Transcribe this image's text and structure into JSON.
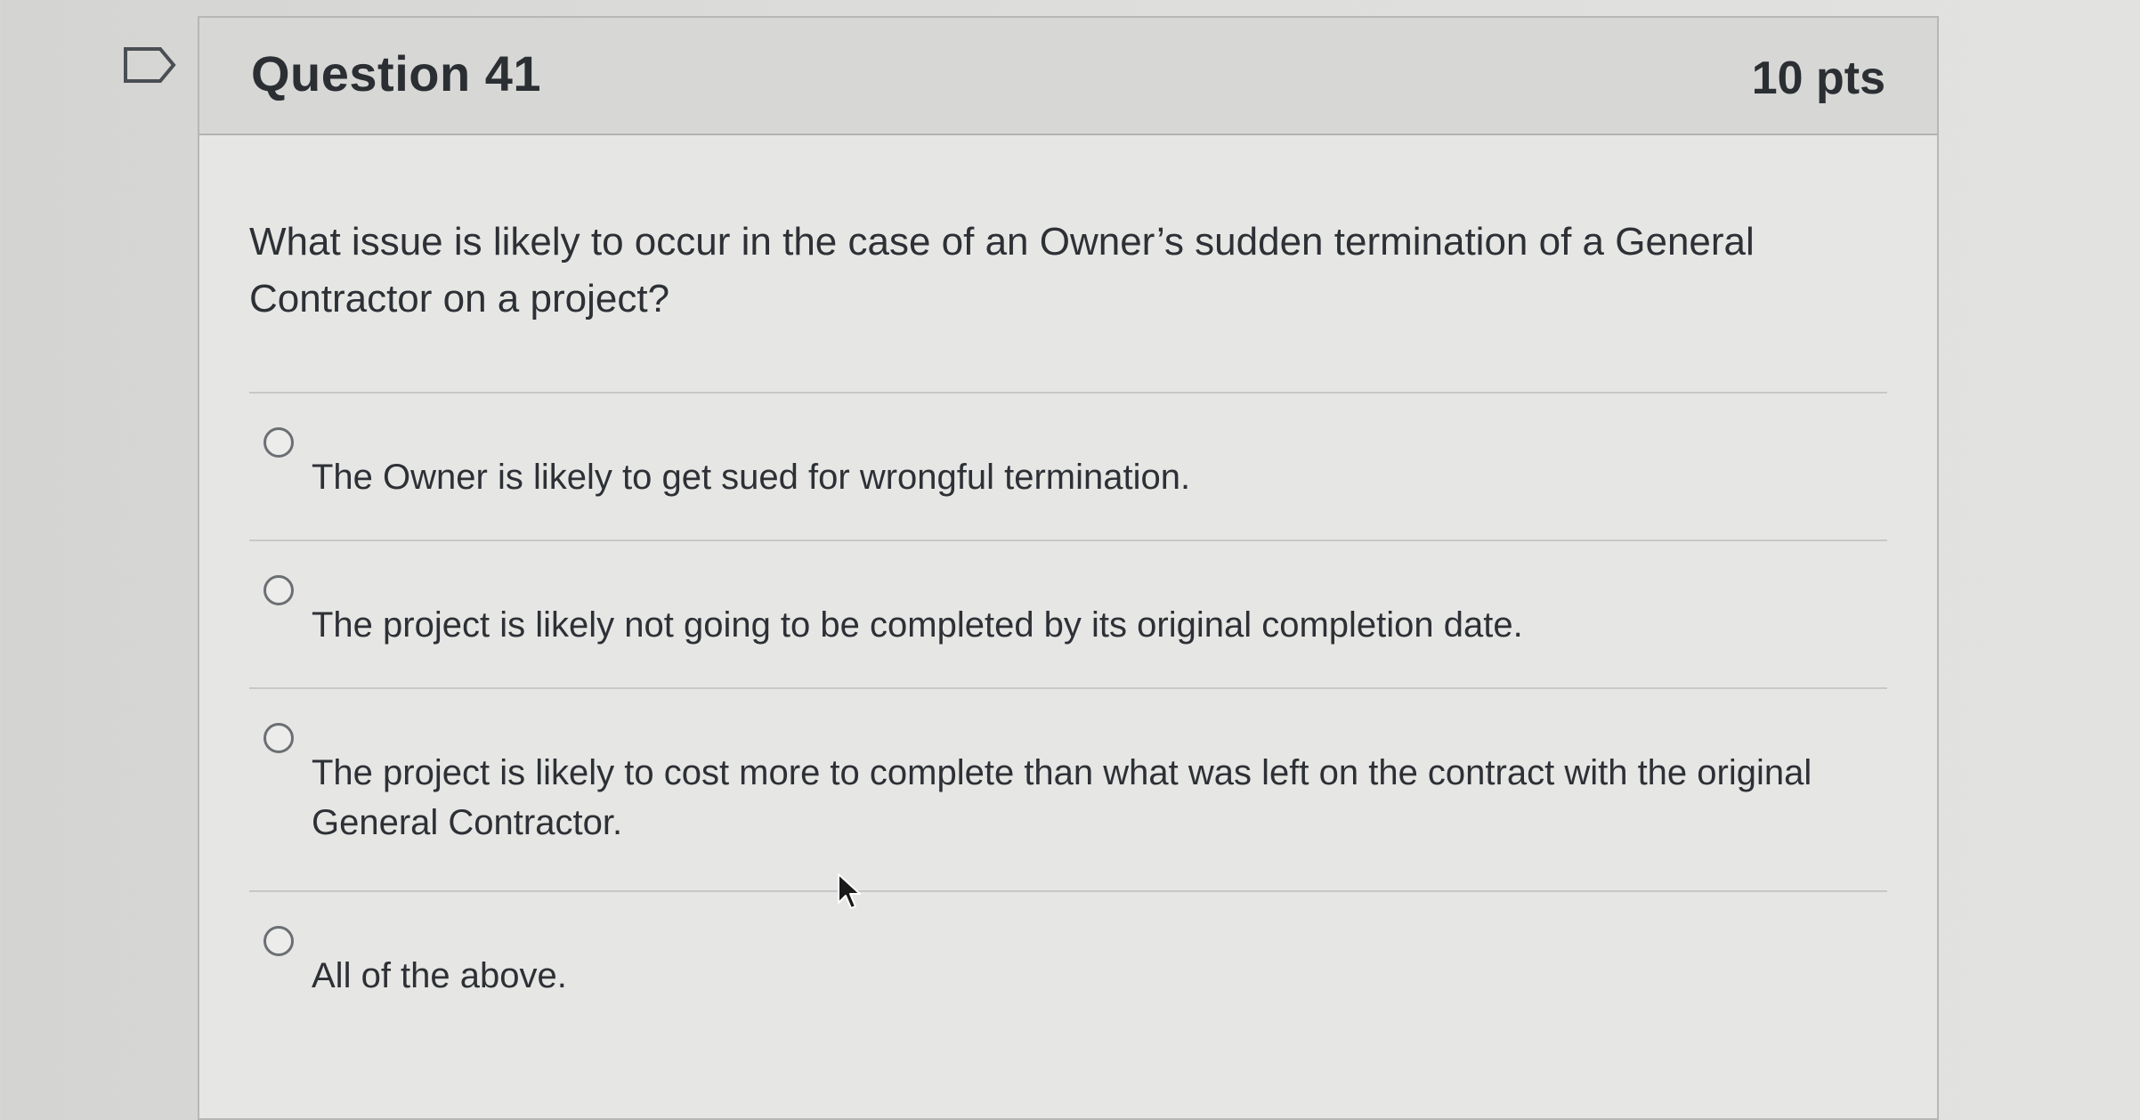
{
  "question": {
    "title": "Question 41",
    "points": "10 pts",
    "text": "What issue is likely to occur in the case of an Owner’s sudden termination of a General Contractor on a project?",
    "flag_icon": "flag-icon"
  },
  "answers": [
    {
      "label": "The Owner is likely to get sued for wrongful termination.",
      "selected": false
    },
    {
      "label": "The project is likely not going to be completed by its original completion date.",
      "selected": false
    },
    {
      "label": "The project is likely to cost more to complete than what was left on the contract with the original General Contractor.",
      "selected": false
    },
    {
      "label": "All of the above.",
      "selected": false
    }
  ],
  "colors": {
    "background": "#dcdcda",
    "header": "#d7d7d5",
    "text": "#2d3035",
    "radio_border": "#6b6f73"
  }
}
